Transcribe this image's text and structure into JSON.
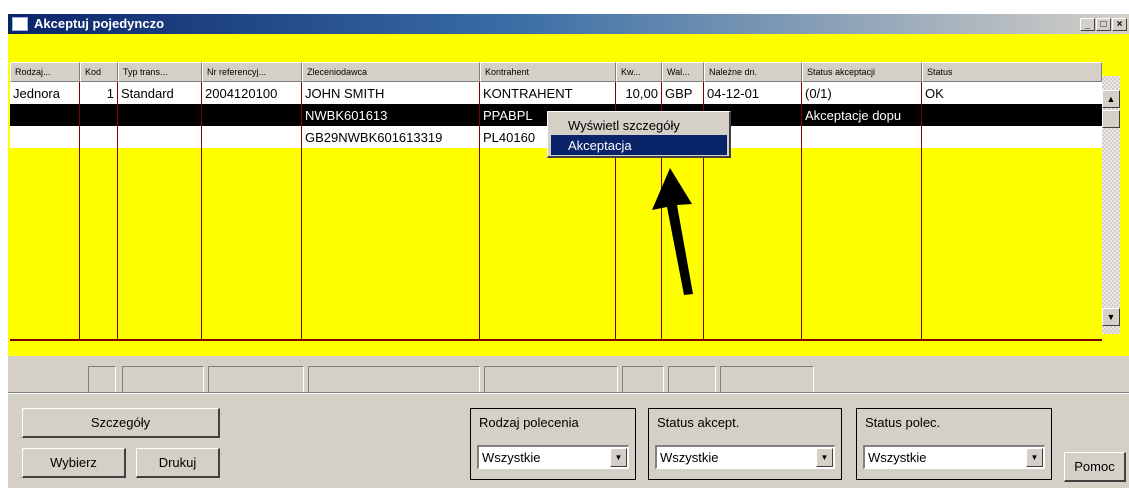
{
  "window": {
    "title": "Akceptuj pojedynczo",
    "buttons": [
      "_",
      "□",
      "×"
    ]
  },
  "grid": {
    "columns": [
      "Rodzaj...",
      "Kod",
      "Typ trans...",
      "Nr referencyj...",
      "Zleceniodawca",
      "Kontrahent",
      "Kw...",
      "Wal...",
      "Należne dn.",
      "Status akceptacji",
      "Status"
    ],
    "rows": [
      [
        "Jednora",
        "1",
        "Standard",
        "2004120100",
        "JOHN SMITH",
        "KONTRAHENT",
        "10,00",
        "GBP",
        "04-12-01",
        "(0/1)",
        "OK"
      ],
      [
        "",
        "",
        "",
        "",
        "NWBK601613",
        "PPABPL",
        "",
        "",
        "",
        "Akceptacje dopu",
        ""
      ],
      [
        "",
        "",
        "",
        "",
        "GB29NWBK601613319",
        "PL40160",
        "",
        "",
        "",
        "",
        ""
      ]
    ]
  },
  "context_menu": {
    "items": [
      "Wyświetl szczegóły",
      "Akceptacja"
    ],
    "selected_index": 1
  },
  "buttons": {
    "details": "Szczegóły",
    "select": "Wybierz",
    "print": "Drukuj",
    "help": "Pomoc"
  },
  "filters": [
    {
      "label": "Rodzaj polecenia",
      "value": "Wszystkie"
    },
    {
      "label": "Status akcept.",
      "value": "Wszystkie"
    },
    {
      "label": "Status polec.",
      "value": "Wszystkie"
    }
  ],
  "colors": {
    "panel": "#ffff00",
    "grid_lines": "#800000",
    "selected_row": "#000000",
    "menu_highlight": "#0a246a"
  }
}
